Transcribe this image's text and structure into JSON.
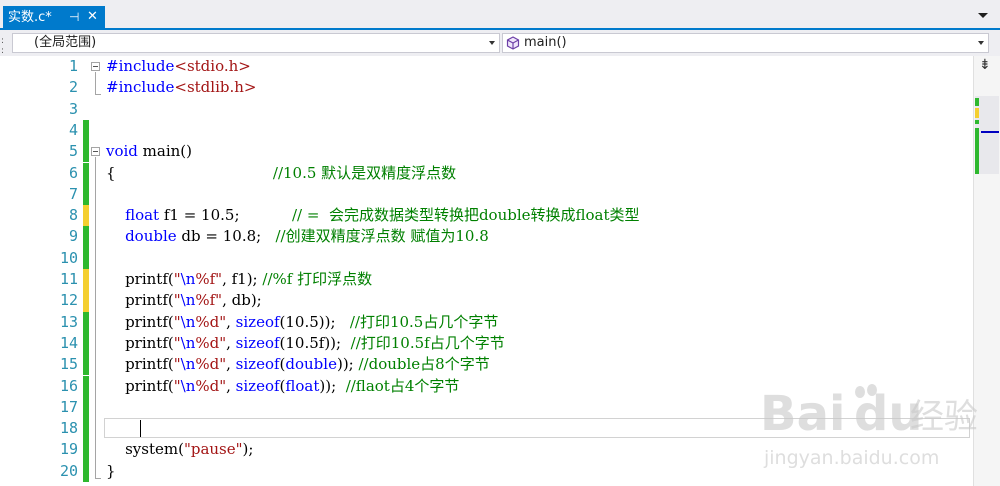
{
  "tab": {
    "title": "实数.c*",
    "pin_glyph": "⊣",
    "close_glyph": "✕"
  },
  "nav": {
    "scope": "(全局范围)",
    "member": "main()"
  },
  "editor": {
    "lines": [
      {
        "n": "1",
        "collapse": true,
        "chg": "",
        "tokens": [
          {
            "t": "#include",
            "c": "k"
          },
          {
            "t": "<stdio.h>",
            "c": "s"
          }
        ]
      },
      {
        "n": "2",
        "collapse": false,
        "chg": "",
        "tokens": [
          {
            "t": "#include",
            "c": "k"
          },
          {
            "t": "<stdlib.h>",
            "c": "s"
          }
        ]
      },
      {
        "n": "3",
        "collapse": false,
        "chg": "",
        "tokens": []
      },
      {
        "n": "4",
        "collapse": false,
        "chg": "green",
        "tokens": []
      },
      {
        "n": "5",
        "collapse": true,
        "chg": "green",
        "tokens": [
          {
            "t": "void",
            "c": "k"
          },
          {
            "t": " main()",
            "c": ""
          }
        ]
      },
      {
        "n": "6",
        "collapse": false,
        "chg": "green",
        "tokens": [
          {
            "t": "{                                 ",
            "c": ""
          },
          {
            "t": "//10.5 默认是双精度浮点数",
            "c": "c"
          }
        ]
      },
      {
        "n": "7",
        "collapse": false,
        "chg": "green",
        "tokens": []
      },
      {
        "n": "8",
        "collapse": false,
        "chg": "yellow",
        "tokens": [
          {
            "t": "    ",
            "c": ""
          },
          {
            "t": "float",
            "c": "k"
          },
          {
            "t": " f1 = 10.5;           ",
            "c": ""
          },
          {
            "t": "// =  会完成数据类型转换把double转换成float类型",
            "c": "c"
          }
        ]
      },
      {
        "n": "9",
        "collapse": false,
        "chg": "green",
        "tokens": [
          {
            "t": "    ",
            "c": ""
          },
          {
            "t": "double",
            "c": "k"
          },
          {
            "t": " db = 10.8;   ",
            "c": ""
          },
          {
            "t": "//创建双精度浮点数 赋值为10.8",
            "c": "c"
          }
        ]
      },
      {
        "n": "10",
        "collapse": false,
        "chg": "green",
        "tokens": []
      },
      {
        "n": "11",
        "collapse": false,
        "chg": "yellow",
        "tokens": [
          {
            "t": "    printf(",
            "c": ""
          },
          {
            "t": "\"",
            "c": "s"
          },
          {
            "t": "\\n",
            "c": "e"
          },
          {
            "t": "%f\"",
            "c": "s"
          },
          {
            "t": ", f1); ",
            "c": ""
          },
          {
            "t": "//%f 打印浮点数",
            "c": "c"
          }
        ]
      },
      {
        "n": "12",
        "collapse": false,
        "chg": "yellow",
        "tokens": [
          {
            "t": "    printf(",
            "c": ""
          },
          {
            "t": "\"",
            "c": "s"
          },
          {
            "t": "\\n",
            "c": "e"
          },
          {
            "t": "%f\"",
            "c": "s"
          },
          {
            "t": ", db);",
            "c": ""
          }
        ]
      },
      {
        "n": "13",
        "collapse": false,
        "chg": "green",
        "tokens": [
          {
            "t": "    printf(",
            "c": ""
          },
          {
            "t": "\"",
            "c": "s"
          },
          {
            "t": "\\n",
            "c": "e"
          },
          {
            "t": "%d\"",
            "c": "s"
          },
          {
            "t": ", ",
            "c": ""
          },
          {
            "t": "sizeof",
            "c": "k"
          },
          {
            "t": "(10.5));   ",
            "c": ""
          },
          {
            "t": "//打印10.5占几个字节",
            "c": "c"
          }
        ]
      },
      {
        "n": "14",
        "collapse": false,
        "chg": "green",
        "tokens": [
          {
            "t": "    printf(",
            "c": ""
          },
          {
            "t": "\"",
            "c": "s"
          },
          {
            "t": "\\n",
            "c": "e"
          },
          {
            "t": "%d\"",
            "c": "s"
          },
          {
            "t": ", ",
            "c": ""
          },
          {
            "t": "sizeof",
            "c": "k"
          },
          {
            "t": "(10.5f));  ",
            "c": ""
          },
          {
            "t": "//打印10.5f占几个字节",
            "c": "c"
          }
        ]
      },
      {
        "n": "15",
        "collapse": false,
        "chg": "green",
        "tokens": [
          {
            "t": "    printf(",
            "c": ""
          },
          {
            "t": "\"",
            "c": "s"
          },
          {
            "t": "\\n",
            "c": "e"
          },
          {
            "t": "%d\"",
            "c": "s"
          },
          {
            "t": ", ",
            "c": ""
          },
          {
            "t": "sizeof",
            "c": "k"
          },
          {
            "t": "(",
            "c": ""
          },
          {
            "t": "double",
            "c": "k"
          },
          {
            "t": ")); ",
            "c": ""
          },
          {
            "t": "//double占8个字节",
            "c": "c"
          }
        ]
      },
      {
        "n": "16",
        "collapse": false,
        "chg": "green",
        "tokens": [
          {
            "t": "    printf(",
            "c": ""
          },
          {
            "t": "\"",
            "c": "s"
          },
          {
            "t": "\\n",
            "c": "e"
          },
          {
            "t": "%d\"",
            "c": "s"
          },
          {
            "t": ", ",
            "c": ""
          },
          {
            "t": "sizeof",
            "c": "k"
          },
          {
            "t": "(",
            "c": ""
          },
          {
            "t": "float",
            "c": "k"
          },
          {
            "t": "));  ",
            "c": ""
          },
          {
            "t": "//flaot占4个字节",
            "c": "c"
          }
        ]
      },
      {
        "n": "17",
        "collapse": false,
        "chg": "green",
        "tokens": []
      },
      {
        "n": "18",
        "collapse": false,
        "chg": "green",
        "current": true,
        "tokens": []
      },
      {
        "n": "19",
        "collapse": false,
        "chg": "green",
        "tokens": [
          {
            "t": "    system(",
            "c": ""
          },
          {
            "t": "\"pause\"",
            "c": "s"
          },
          {
            "t": ");",
            "c": ""
          }
        ]
      },
      {
        "n": "20",
        "collapse": false,
        "chg": "green",
        "tokens": [
          {
            "t": "}",
            "c": ""
          }
        ]
      }
    ]
  },
  "watermark": {
    "brand": "Bai",
    "brand2": "du",
    "suffix": "经验",
    "url": "jingyan.baidu.com"
  },
  "colors": {
    "accent": "#007acc",
    "change_saved": "#2eb82e",
    "change_unsaved": "#f4cf30",
    "line_number": "#2b91af",
    "keyword": "#0000ff",
    "string": "#a31515",
    "comment": "#008000"
  }
}
